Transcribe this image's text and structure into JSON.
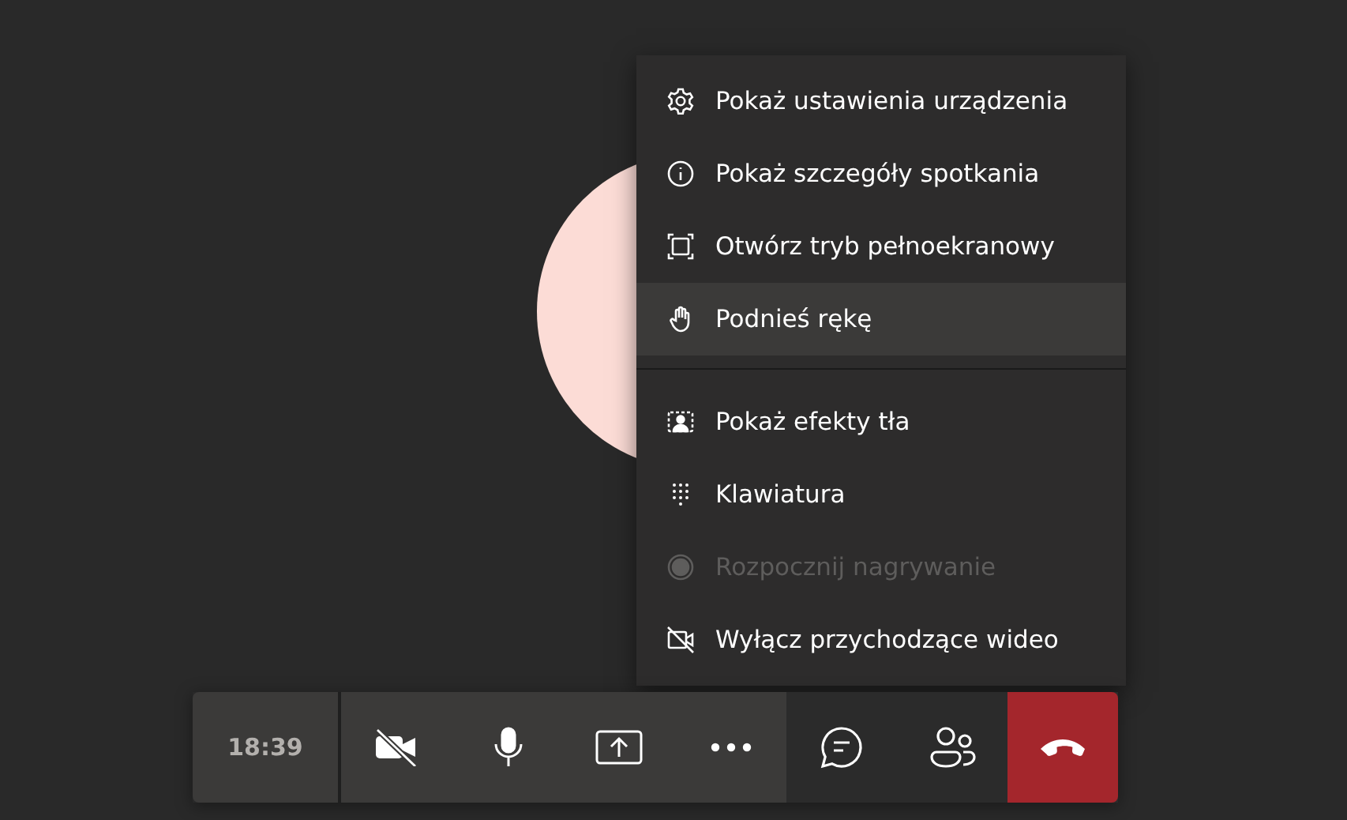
{
  "menu": {
    "sections": [
      {
        "items": [
          {
            "label": "Pokaż ustawienia urządzenia",
            "selected": false,
            "disabled": false
          },
          {
            "label": "Pokaż szczegóły spotkania",
            "selected": false,
            "disabled": false
          },
          {
            "label": "Otwórz tryb pełnoekranowy",
            "selected": false,
            "disabled": false
          },
          {
            "label": "Podnieś rękę",
            "selected": true,
            "disabled": false
          }
        ]
      },
      {
        "items": [
          {
            "label": "Pokaż efekty tła",
            "selected": false,
            "disabled": false
          },
          {
            "label": "Klawiatura",
            "selected": false,
            "disabled": false
          },
          {
            "label": "Rozpocznij nagrywanie",
            "selected": false,
            "disabled": true
          },
          {
            "label": "Wyłącz przychodzące wideo",
            "selected": false,
            "disabled": false
          }
        ]
      }
    ]
  },
  "toolbar": {
    "time": "18:39"
  }
}
